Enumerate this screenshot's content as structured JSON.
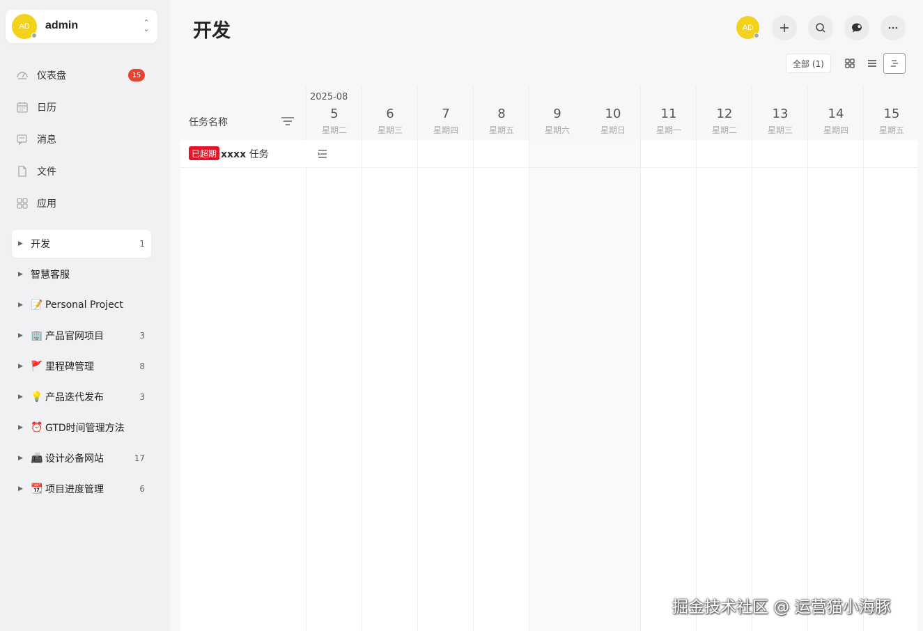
{
  "user": {
    "initials": "AD",
    "name": "admin"
  },
  "nav": [
    {
      "icon": "dashboard-icon",
      "label": "仪表盘",
      "badge": "15"
    },
    {
      "icon": "calendar-icon",
      "label": "日历"
    },
    {
      "icon": "message-icon",
      "label": "消息"
    },
    {
      "icon": "file-icon",
      "label": "文件"
    },
    {
      "icon": "apps-icon",
      "label": "应用"
    }
  ],
  "projects": [
    {
      "emoji": "",
      "label": "开发",
      "count": "1",
      "active": true
    },
    {
      "emoji": "",
      "label": "智慧客服",
      "count": ""
    },
    {
      "emoji": "📝",
      "label": "Personal Project",
      "count": ""
    },
    {
      "emoji": "🏢",
      "label": "产品官网项目",
      "count": "3"
    },
    {
      "emoji": "🚩",
      "label": "里程碑管理",
      "count": "8"
    },
    {
      "emoji": "💡",
      "label": "产品迭代发布",
      "count": "3"
    },
    {
      "emoji": "⏰",
      "label": "GTD时间管理方法",
      "count": ""
    },
    {
      "emoji": "📠",
      "label": "设计必备网站",
      "count": "17"
    },
    {
      "emoji": "📆",
      "label": "项目进度管理",
      "count": "6"
    }
  ],
  "main": {
    "title": "开发",
    "filter_label": "全部 (1)",
    "top_avatar": "AD"
  },
  "gantt": {
    "name_column": "任务名称",
    "month": "2025-08",
    "days": [
      {
        "num": "5",
        "week": "星期二"
      },
      {
        "num": "6",
        "week": "星期三"
      },
      {
        "num": "7",
        "week": "星期四"
      },
      {
        "num": "8",
        "week": "星期五"
      },
      {
        "num": "9",
        "week": "星期六"
      },
      {
        "num": "10",
        "week": "星期日"
      },
      {
        "num": "11",
        "week": "星期一"
      },
      {
        "num": "12",
        "week": "星期二"
      },
      {
        "num": "13",
        "week": "星期三"
      },
      {
        "num": "14",
        "week": "星期四"
      },
      {
        "num": "15",
        "week": "星期五"
      }
    ],
    "tasks": [
      {
        "status": "已超期",
        "title_bold": "xxxx",
        "title_rest": " 任务"
      }
    ]
  },
  "watermark": "掘金技术社区 @ 运营猫小海豚",
  "colors": {
    "accent_yellow": "#f2d21a",
    "badge_red": "#e8442f",
    "overdue_red": "#e0162b"
  }
}
